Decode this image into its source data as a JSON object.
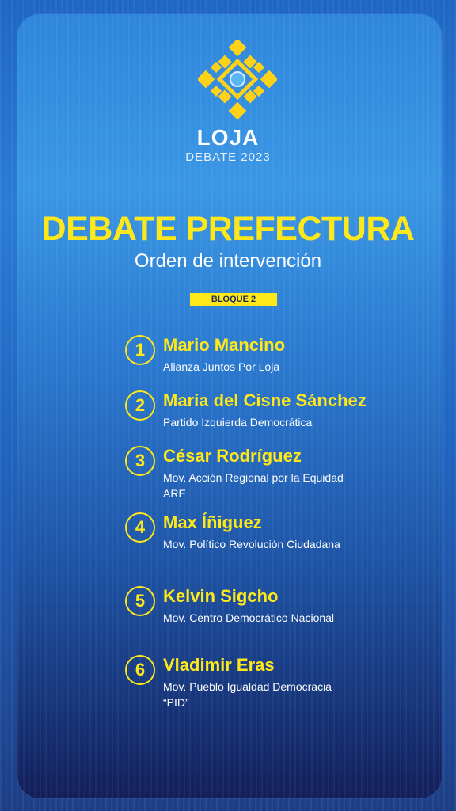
{
  "header": {
    "brand_title": "LOJA",
    "brand_subtitle": "DEBATE 2023",
    "main_title": "DEBATE PREFECTURA",
    "subtitle": "Orden de intervención",
    "block_label": "BLOQUE 2"
  },
  "colors": {
    "accent": "#ffe81a",
    "background": "#1f66c4",
    "text": "#ffffff"
  },
  "candidates": [
    {
      "number": "1",
      "name": "Mario Mancino",
      "party": "Alianza Juntos Por Loja"
    },
    {
      "number": "2",
      "name": "María del Cisne Sánchez",
      "party": "Partido Izquierda Democrática"
    },
    {
      "number": "3",
      "name": "César Rodríguez",
      "party": "Mov. Acción Regional por la Equidad ARE"
    },
    {
      "number": "4",
      "name": "Max Íñiguez",
      "party": "Mov. Político Revolución Ciudadana"
    },
    {
      "number": "5",
      "name": "Kelvin Sigcho",
      "party": "Mov. Centro Democrático Nacional"
    },
    {
      "number": "6",
      "name": "Vladimir Eras",
      "party": "Mov. Pueblo Igualdad Democracia “PID”"
    }
  ]
}
